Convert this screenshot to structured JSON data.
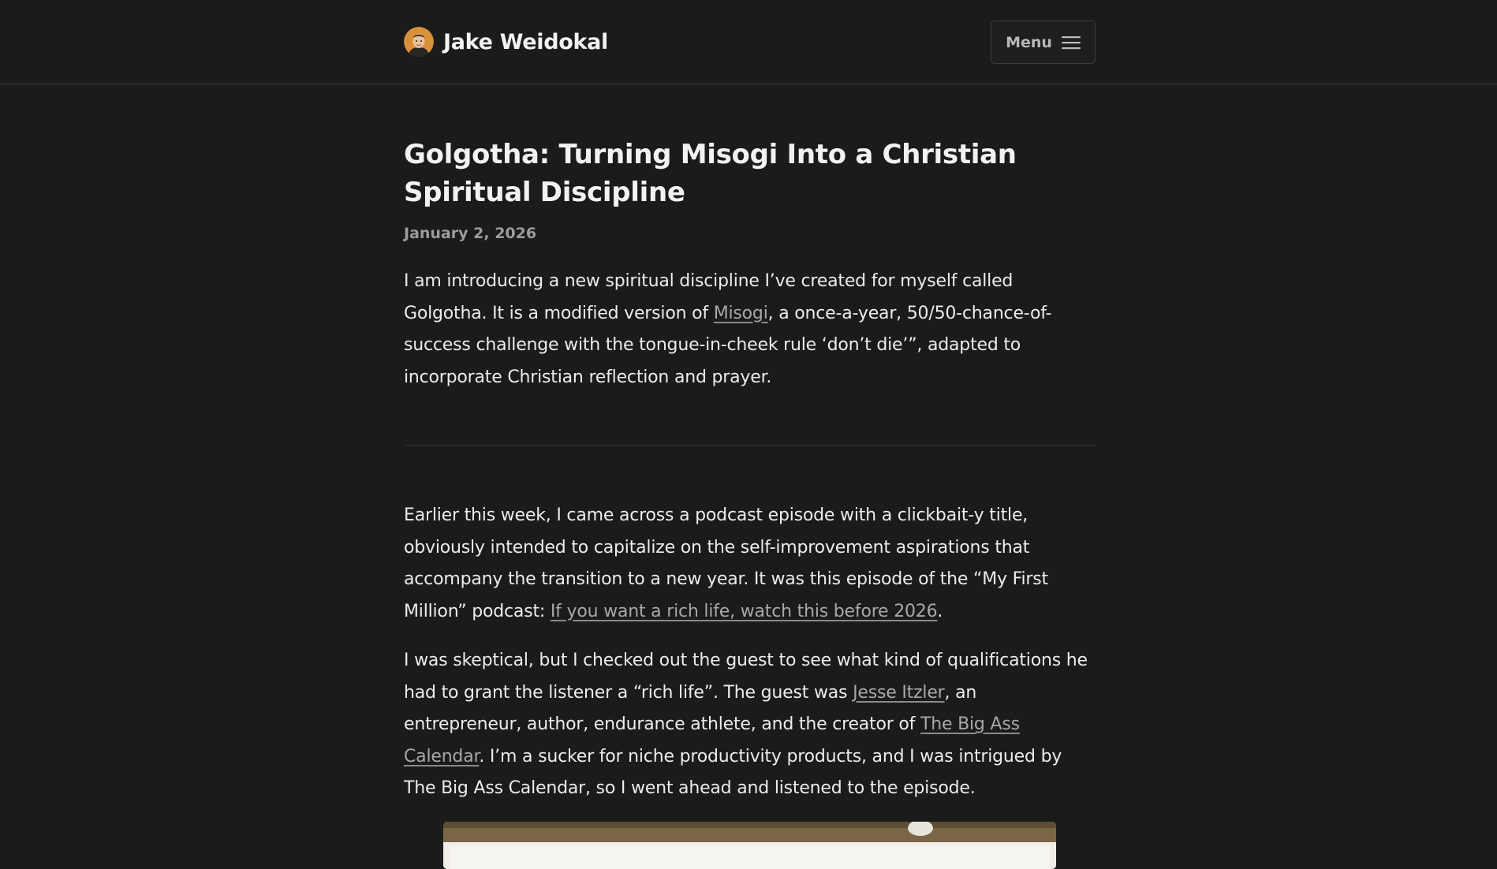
{
  "header": {
    "site_name": "Jake Weidokal",
    "menu_label": "Menu"
  },
  "article": {
    "title": "Golgotha: Turning Misogi Into a Christian Spiritual Discipline",
    "date": "January 2, 2026",
    "p1": {
      "t1": "I am introducing a new spiritual discipline I’ve created for myself called Golgotha. It is a modified version of ",
      "link1": "Misogi",
      "t2": ", a once-a-year, 50/50-chance-of-success challenge with the tongue-in-cheek rule ‘don’t die’”, adapted to incorporate Christian reflection and prayer."
    },
    "p2": {
      "t1": "Earlier this week, I came across a podcast episode with a clickbait-y title, obviously intended to capitalize on the self-improvement aspirations that accompany the transition to a new year. It was this episode of the “My First Million” podcast: ",
      "link1": "If you want a rich life, watch this before 2026",
      "t2": "."
    },
    "p3": {
      "t1": "I was skeptical, but I checked out the guest to see what kind of qualifications he had to grant the listener a “rich life”. The guest was ",
      "link1": "Jesse Itzler",
      "t2": ", an entrepreneur, author, endurance athlete, and the creator of ",
      "link2": "The Big Ass Calendar",
      "t3": ". I’m a sucker for niche productivity products, and I was intrigued by The Big Ass Calendar, so I went ahead and listened to the episode."
    }
  },
  "colors": {
    "background": "#1b1b1c",
    "text": "#ececec",
    "muted": "#9c9c9c",
    "link": "#a8a8a8",
    "border": "#3a3a3c"
  },
  "icons": {
    "avatar": "avatar",
    "menu": "hamburger-icon"
  }
}
